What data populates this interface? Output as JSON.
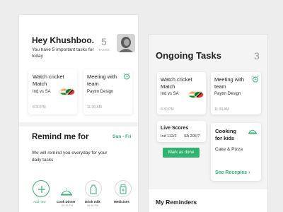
{
  "left": {
    "greeting": "Hey Khushboo.",
    "subtitle": "You have 5 important tasks for today",
    "task_count": "5",
    "task_count_label": "TASKS",
    "cards": [
      {
        "title": "Watch cricket Match",
        "subtitle": "Ind vs SA",
        "time": "8:30 PM"
      },
      {
        "title": "Meeting with team",
        "subtitle": "Paytm Design",
        "time": "11:30 AM"
      }
    ],
    "remind": {
      "title": "Remind me for",
      "days": "Sun - Fri",
      "description": "We will remind you everyday for your daily tasks",
      "items": [
        {
          "label": "Add new",
          "time": "",
          "icon": "plus-icon"
        },
        {
          "label": "Cook Dinner",
          "time": "08:45 PM",
          "icon": "dish-icon"
        },
        {
          "label": "Drink milk",
          "time": "06:30 PM",
          "icon": "bottle-icon"
        },
        {
          "label": "Medicines",
          "time": "",
          "icon": "medicine-icon"
        }
      ]
    }
  },
  "right": {
    "title": "Ongoing Tasks",
    "count": "3",
    "cards": [
      {
        "title": "Watch cricket Match",
        "subtitle": "Ind vs SA",
        "time": "8:30 PM"
      },
      {
        "title": "Meeting with team",
        "subtitle": "Paytm Design",
        "time": "11:30 AM"
      }
    ],
    "live": {
      "title": "Live Scores",
      "ind": "Ind 112/2",
      "sa": "SA 205/7"
    },
    "mark_done": "Mark as done",
    "cooking": {
      "title": "Cooking for kids",
      "subtitle": "Cake & Pizza",
      "link": "See Recepies"
    },
    "reminders_title": "My Reminders"
  },
  "colors": {
    "accent": "#2fb36d",
    "muted": "#9a9a9a"
  }
}
